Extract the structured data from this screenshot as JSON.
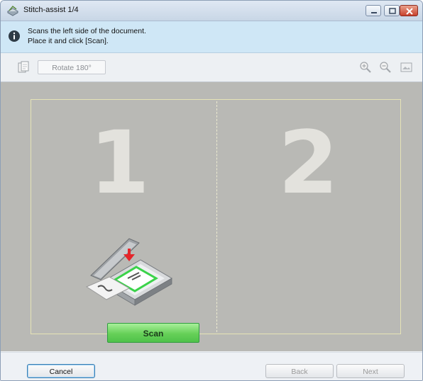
{
  "window": {
    "title": "Stitch-assist 1/4"
  },
  "info": {
    "line1": "Scans the left side of the document.",
    "line2": "Place it and click [Scan]."
  },
  "toolbar": {
    "rotate_label": "Rotate 180°"
  },
  "canvas": {
    "left_page_number": "1",
    "right_page_number": "2",
    "scan_label": "Scan"
  },
  "footer": {
    "cancel_label": "Cancel",
    "back_label": "Back",
    "next_label": "Next"
  },
  "colors": {
    "info_bar": "#cfe7f6",
    "canvas": "#b9b9b5",
    "scan_button": "#66d058",
    "target_outline": "#3bd34a",
    "arrow": "#e4262b"
  },
  "icons": {
    "title": "scanner-app-icon",
    "info": "info-icon",
    "page": "page-icon",
    "zoom_in": "zoom-in-icon",
    "zoom_out": "zoom-out-icon",
    "fit": "fit-to-window-icon"
  }
}
